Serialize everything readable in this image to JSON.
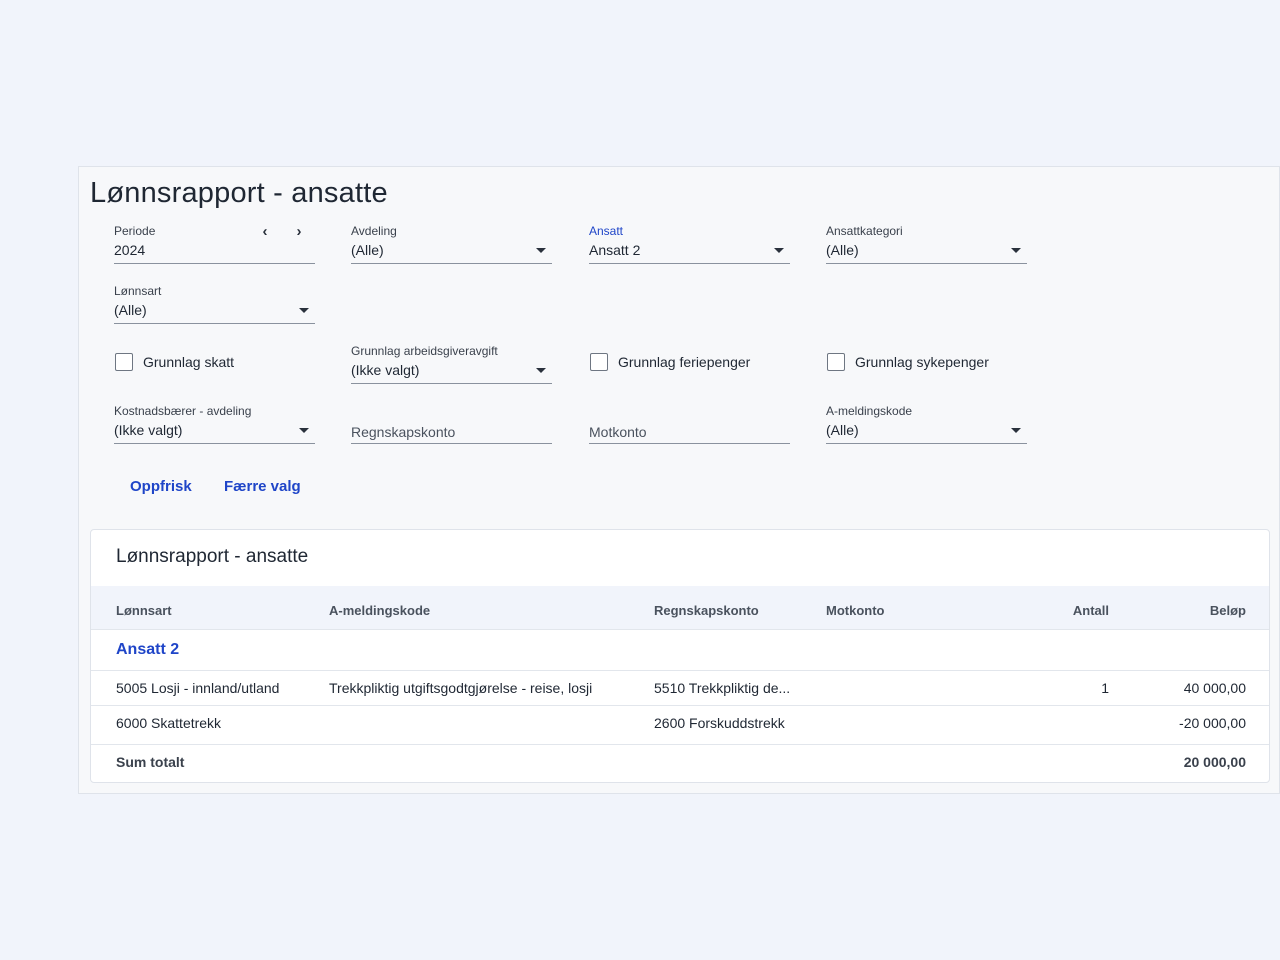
{
  "page": {
    "title": "Lønnsrapport - ansatte"
  },
  "filters": {
    "periode": {
      "label": "Periode",
      "value": "2024",
      "prev_icon": "chevron-left-icon",
      "next_icon": "chevron-right-icon"
    },
    "avdeling": {
      "label": "Avdeling",
      "value": "(Alle)"
    },
    "ansatt": {
      "label": "Ansatt",
      "value": "Ansatt 2"
    },
    "ansattkategori": {
      "label": "Ansattkategori",
      "value": "(Alle)"
    },
    "lonnsart": {
      "label": "Lønnsart",
      "value": "(Alle)"
    },
    "grunnlag_arbeidsgiveravgift": {
      "label": "Grunnlag arbeidsgiveravgift",
      "value": "(Ikke valgt)"
    },
    "kostnadsbaerer": {
      "label": "Kostnadsbærer - avdeling",
      "value": "(Ikke valgt)"
    },
    "regnskapskonto": {
      "placeholder": "Regnskapskonto"
    },
    "motkonto": {
      "placeholder": "Motkonto"
    },
    "a_meldingskode": {
      "label": "A-meldingskode",
      "value": "(Alle)"
    }
  },
  "checkboxes": {
    "grunnlag_skatt": {
      "label": "Grunnlag skatt",
      "checked": false
    },
    "grunnlag_feriepenger": {
      "label": "Grunnlag feriepenger",
      "checked": false
    },
    "grunnlag_sykepenger": {
      "label": "Grunnlag sykepenger",
      "checked": false
    }
  },
  "actions": {
    "refresh": "Oppfrisk",
    "fewer": "Færre valg"
  },
  "report": {
    "title": "Lønnsrapport - ansatte",
    "columns": {
      "lonnsart": "Lønnsart",
      "a_meldingskode": "A-meldingskode",
      "regnskapskonto": "Regnskapskonto",
      "motkonto": "Motkonto",
      "antall": "Antall",
      "belop": "Beløp"
    },
    "group": "Ansatt 2",
    "rows": [
      {
        "lonnsart": "5005 Losji - innland/utland",
        "a_meldingskode": "Trekkpliktig utgiftsgodtgjørelse - reise, losji",
        "regnskapskonto": "5510 Trekkpliktig de...",
        "motkonto": "",
        "antall": "1",
        "belop": "40 000,00"
      },
      {
        "lonnsart": "6000 Skattetrekk",
        "a_meldingskode": "",
        "regnskapskonto": "2600 Forskuddstrekk",
        "motkonto": "",
        "antall": "",
        "belop": "-20 000,00"
      }
    ],
    "total": {
      "label": "Sum totalt",
      "belop": "20 000,00"
    }
  },
  "colors": {
    "accent": "#1f45c8",
    "background": "#f1f4fb"
  }
}
